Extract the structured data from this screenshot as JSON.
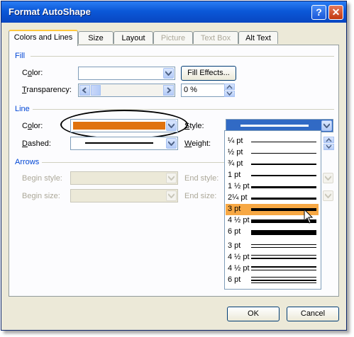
{
  "window": {
    "title": "Format AutoShape"
  },
  "title_buttons": {
    "help": "?",
    "close": "✕"
  },
  "tabs": [
    {
      "label": "Colors and Lines"
    },
    {
      "label": "Size"
    },
    {
      "label": "Layout"
    },
    {
      "label": "Picture"
    },
    {
      "label": "Text Box"
    },
    {
      "label": "Alt Text"
    }
  ],
  "fill": {
    "section": "Fill",
    "color_label_pre": "C",
    "color_label_mn": "o",
    "color_label_post": "lor:",
    "fill_effects": "Fill Effects...",
    "transparency_label_mn": "T",
    "transparency_label_post": "ransparency:",
    "transparency_value": "0 %"
  },
  "line": {
    "section": "Line",
    "color_label_pre": "C",
    "color_label_mn": "o",
    "color_label_post": "lor:",
    "color_value": "#e0720e",
    "style_label_pre": "",
    "style_label_mn": "S",
    "style_label_post": "tyle:",
    "dashed_label_mn": "D",
    "dashed_label_post": "ashed:",
    "weight_label_mn": "W",
    "weight_label_post": "eight:"
  },
  "arrows": {
    "section": "Arrows",
    "begin_style": "Begin style:",
    "begin_size": "Begin size:",
    "end_style": "End style:",
    "end_size": "End size:"
  },
  "style_options": [
    {
      "label": "¼ pt"
    },
    {
      "label": "½ pt"
    },
    {
      "label": "¾ pt"
    },
    {
      "label": "1 pt"
    },
    {
      "label": "1 ½ pt"
    },
    {
      "label": "2¼ pt"
    },
    {
      "label": "3 pt",
      "selected": true
    },
    {
      "label": "4 ½ pt"
    },
    {
      "label": "6 pt"
    },
    {
      "label": "3 pt"
    },
    {
      "label": "4 ½ pt"
    },
    {
      "label": "4 ½ pt"
    },
    {
      "label": "6 pt"
    }
  ],
  "buttons": {
    "ok": "OK",
    "cancel": "Cancel"
  },
  "colors": {
    "selection": "#f7a844",
    "accent": "#e0720e"
  }
}
